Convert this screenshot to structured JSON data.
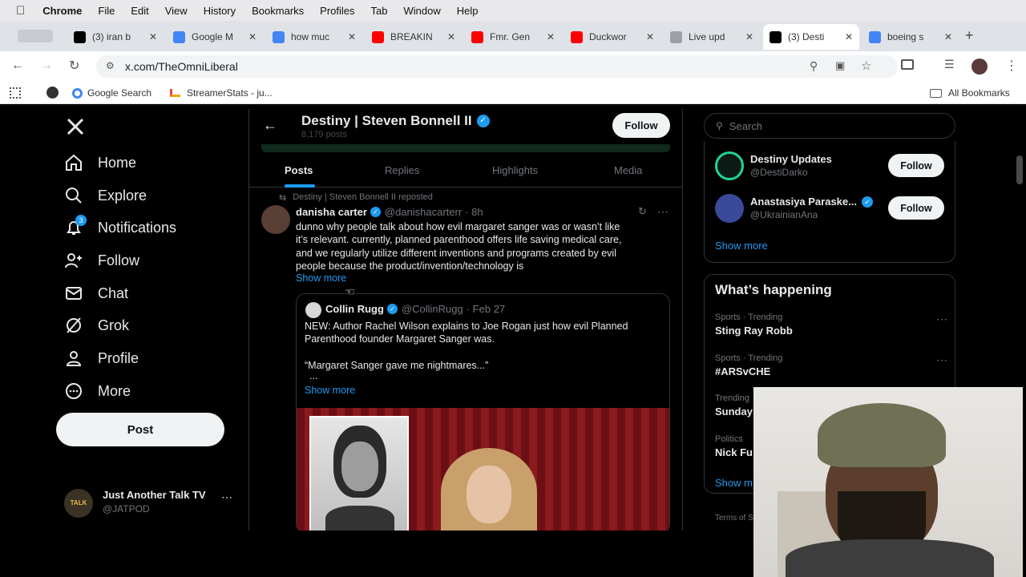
{
  "menubar": {
    "app": "Chrome",
    "items": [
      "File",
      "Edit",
      "View",
      "History",
      "Bookmarks",
      "Profiles",
      "Tab",
      "Window",
      "Help"
    ]
  },
  "tabs": [
    {
      "title": "(3) iran b",
      "color": "#000000"
    },
    {
      "title": "Google M",
      "color": "#4285f4"
    },
    {
      "title": "how muc",
      "color": "#4285f4"
    },
    {
      "title": "BREAKIN",
      "color": "#ff0000"
    },
    {
      "title": "Fmr. Gen",
      "color": "#ff0000"
    },
    {
      "title": "Duckwor",
      "color": "#ff0000"
    },
    {
      "title": "Live upd",
      "color": "#9aa0a6"
    },
    {
      "title": "(3) Desti",
      "color": "#000000"
    },
    {
      "title": "boeing s",
      "color": "#4285f4"
    }
  ],
  "address": {
    "url": "x.com/TheOmniLiberal"
  },
  "bookmarks": {
    "google": "Google Search",
    "streamer": "StreamerStats - ju...",
    "all": "All Bookmarks"
  },
  "nav": {
    "items": [
      "Home",
      "Explore",
      "Notifications",
      "Follow",
      "Chat",
      "Grok",
      "Profile",
      "More"
    ],
    "notif_count": "3",
    "post": "Post"
  },
  "account": {
    "name": "Just Another Talk TV",
    "handle": "@JATPOD"
  },
  "profile": {
    "name": "Destiny | Steven Bonnell II",
    "posts": "8,179 posts",
    "follow": "Follow"
  },
  "tabsrow": {
    "items": [
      "Posts",
      "Replies",
      "Highlights",
      "Media"
    ]
  },
  "tweet": {
    "repost": "Destiny | Steven Bonnell II reposted",
    "author": "danisha carter",
    "handle": "@danishacarterr",
    "time": "· 8h",
    "line1": "dunno why people talk about how evil margaret sanger was or wasn’t like",
    "line2": "it’s relevant. currently, planned parenthood offers life saving medical care,",
    "line3": "and we regularly utilize different inventions and programs created by evil",
    "line4": "people because the product/invention/technology is",
    "show_more": "Show more"
  },
  "quote": {
    "author": "Collin Rugg",
    "handle": "@CollinRugg",
    "time": "· Feb 27",
    "line1": "NEW: Author Rachel Wilson explains to Joe Rogan just how evil Planned",
    "line2": "Parenthood founder Margaret Sanger was.",
    "line3": "“Margaret Sanger gave me nightmares...”",
    "ellipsis": "...",
    "show_more": "Show more"
  },
  "search": {
    "placeholder": "Search"
  },
  "who": [
    {
      "name": "Destiny Updates",
      "handle": "@DestiDarko",
      "btn": "Follow"
    },
    {
      "name": "Anastasiya Paraske...",
      "handle": "@UkrainianAna",
      "btn": "Follow"
    }
  ],
  "who_more": "Show more",
  "happening": {
    "title": "What’s happening",
    "show_more": "Show m",
    "trends": [
      {
        "cat": "Sports · Trending",
        "name": "Sting Ray Robb"
      },
      {
        "cat": "Sports · Trending",
        "name": "#ARSvCHE"
      },
      {
        "cat": "Trending",
        "name": "Sunday"
      },
      {
        "cat": "Politics",
        "name": "Nick Fu"
      }
    ]
  },
  "footer": "Terms of S"
}
